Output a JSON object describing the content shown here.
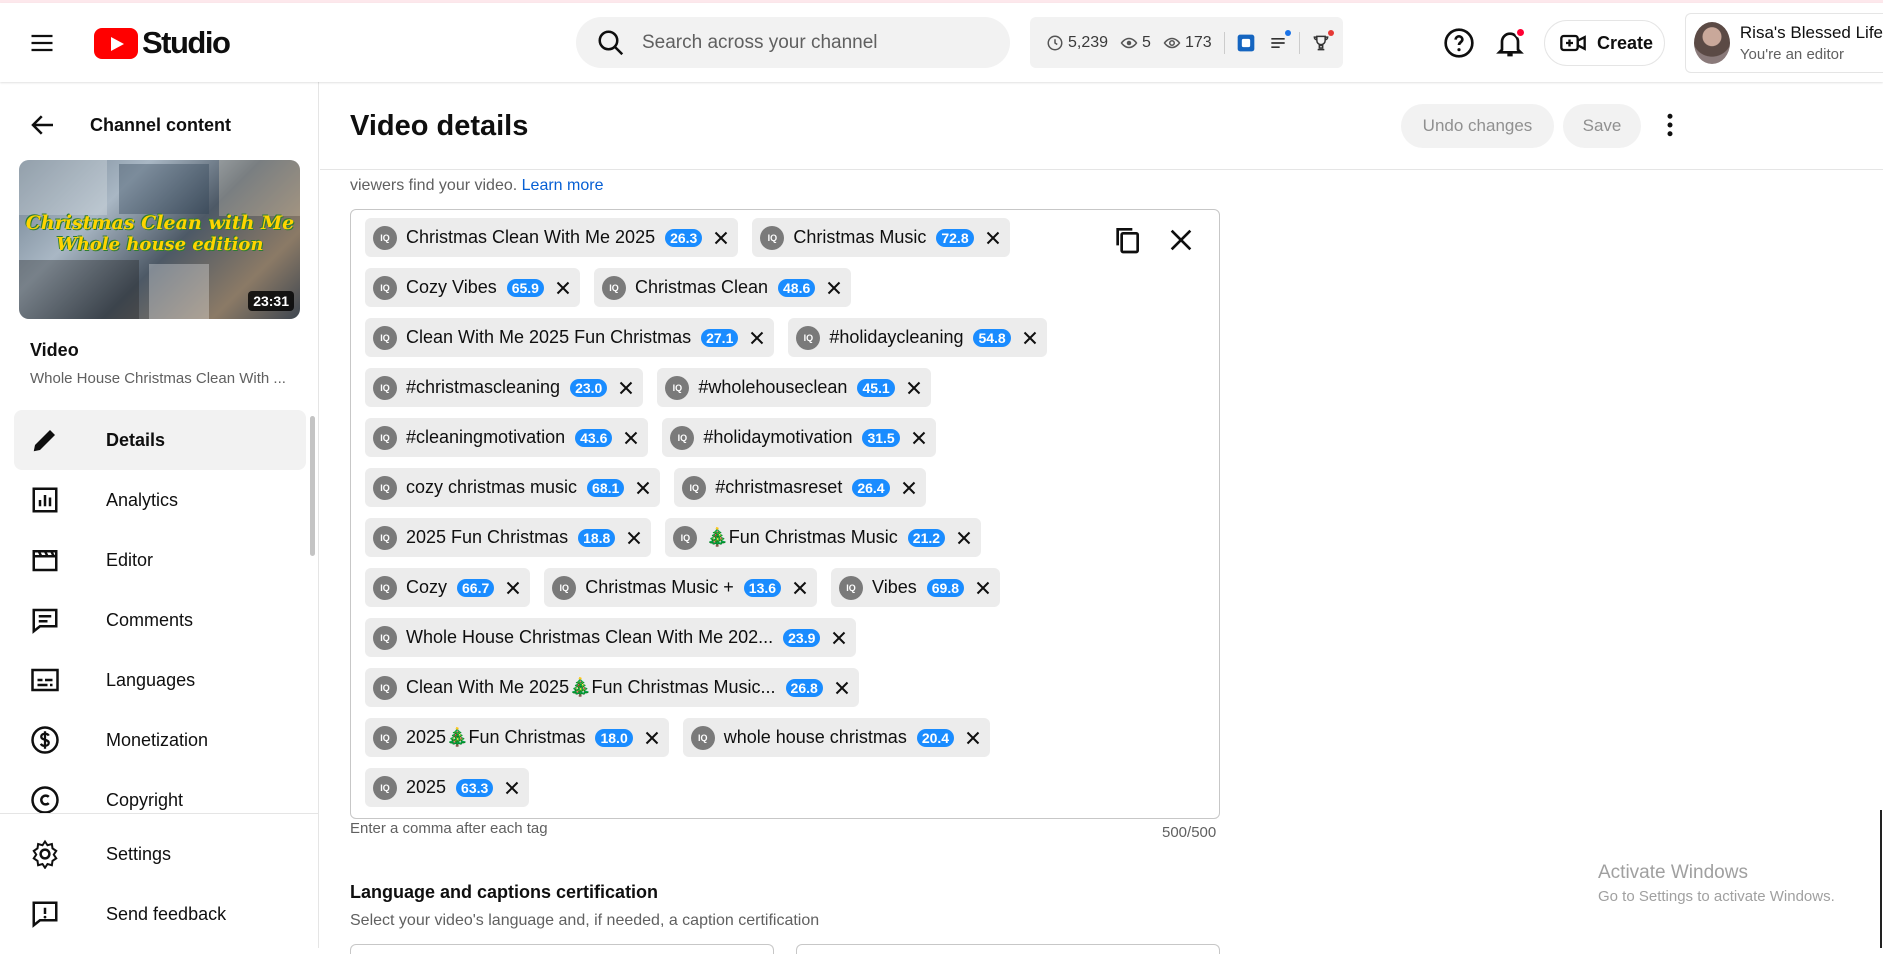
{
  "header": {
    "brand": "Studio",
    "search_placeholder": "Search across your channel",
    "stats": {
      "watch_hours": "5,239",
      "views_48h": "5",
      "views_live": "173"
    },
    "create_label": "Create",
    "account": {
      "name": "Risa's Blessed Life",
      "role": "You're an editor"
    }
  },
  "sidebar": {
    "back_label": "Channel content",
    "thumbnail": {
      "line1": "Christmas Clean with Me",
      "line2": "Whole house edition",
      "duration": "23:31"
    },
    "video_label": "Video",
    "video_title": "Whole House Christmas Clean With ...",
    "nav": [
      {
        "label": "Details",
        "icon": "pencil-icon",
        "active": true
      },
      {
        "label": "Analytics",
        "icon": "analytics-icon"
      },
      {
        "label": "Editor",
        "icon": "clapperboard-icon"
      },
      {
        "label": "Comments",
        "icon": "comments-icon"
      },
      {
        "label": "Languages",
        "icon": "subtitles-icon"
      },
      {
        "label": "Monetization",
        "icon": "dollar-icon"
      },
      {
        "label": "Copyright",
        "icon": "copyright-icon"
      }
    ],
    "bottom_nav": [
      {
        "label": "Settings",
        "icon": "gear-icon"
      },
      {
        "label": "Send feedback",
        "icon": "feedback-icon"
      }
    ]
  },
  "main": {
    "title": "Video details",
    "undo_label": "Undo changes",
    "save_label": "Save",
    "help_text": "viewers find your video.",
    "learn_more": "Learn more",
    "tags": [
      {
        "text": "Christmas Clean With Me 2025",
        "score": "26.3"
      },
      {
        "text": "Christmas Music",
        "score": "72.8"
      },
      {
        "text": "Cozy Vibes",
        "score": "65.9"
      },
      {
        "text": "Christmas Clean",
        "score": "48.6"
      },
      {
        "text": "Clean With Me 2025 Fun Christmas",
        "score": "27.1"
      },
      {
        "text": "#holidaycleaning",
        "score": "54.8"
      },
      {
        "text": "#christmascleaning",
        "score": "23.0"
      },
      {
        "text": "#wholehouseclean",
        "score": "45.1"
      },
      {
        "text": "#cleaningmotivation",
        "score": "43.6"
      },
      {
        "text": "#holidaymotivation",
        "score": "31.5"
      },
      {
        "text": "cozy christmas music",
        "score": "68.1"
      },
      {
        "text": "#christmasreset",
        "score": "26.4"
      },
      {
        "text": "2025 Fun Christmas",
        "score": "18.8"
      },
      {
        "text": "🎄Fun Christmas Music",
        "score": "21.2"
      },
      {
        "text": "Cozy",
        "score": "66.7"
      },
      {
        "text": "Christmas Music +",
        "score": "13.6"
      },
      {
        "text": "Vibes",
        "score": "69.8"
      },
      {
        "text": "Whole House Christmas Clean With Me 202...",
        "score": "23.9"
      },
      {
        "text": "Clean With Me 2025🎄Fun Christmas Music...",
        "score": "26.8"
      },
      {
        "text": "2025🎄Fun Christmas",
        "score": "18.0"
      },
      {
        "text": "whole house christmas",
        "score": "20.4"
      },
      {
        "text": "2025",
        "score": "63.3"
      }
    ],
    "tags_hint": "Enter a comma after each tag",
    "tags_count": "500/500",
    "lang_section_title": "Language and captions certification",
    "lang_section_sub": "Select your video's language and, if needed, a caption certification"
  },
  "watermark": {
    "line1": "Activate Windows",
    "line2": "Go to Settings to activate Windows."
  },
  "colors": {
    "brand_red": "#ff0000",
    "score_blue": "#1a8cff",
    "link_blue": "#065fd4"
  }
}
